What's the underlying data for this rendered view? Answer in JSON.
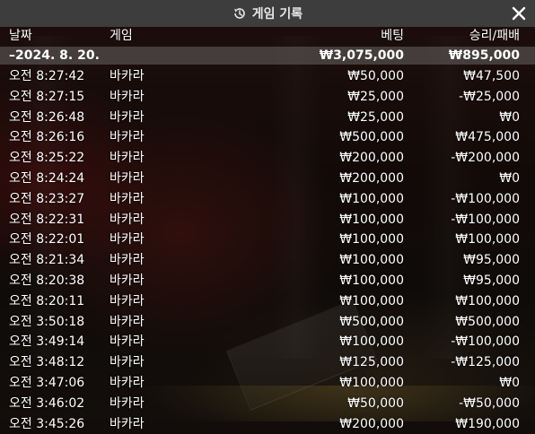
{
  "title": "게임 기록",
  "columns": {
    "date": "날짜",
    "game": "게임",
    "bet": "베팅",
    "winloss": "승리/패배"
  },
  "total": {
    "date": "–2024. 8. 20.",
    "bet": "₩3,075,000",
    "winloss": "₩895,000"
  },
  "rows": [
    {
      "time": "오전 8:27:42",
      "game": "바카라",
      "bet": "₩50,000",
      "winloss": "₩47,500"
    },
    {
      "time": "오전 8:27:15",
      "game": "바카라",
      "bet": "₩25,000",
      "winloss": "-₩25,000"
    },
    {
      "time": "오전 8:26:48",
      "game": "바카라",
      "bet": "₩25,000",
      "winloss": "₩0"
    },
    {
      "time": "오전 8:26:16",
      "game": "바카라",
      "bet": "₩500,000",
      "winloss": "₩475,000"
    },
    {
      "time": "오전 8:25:22",
      "game": "바카라",
      "bet": "₩200,000",
      "winloss": "-₩200,000"
    },
    {
      "time": "오전 8:24:24",
      "game": "바카라",
      "bet": "₩200,000",
      "winloss": "₩0"
    },
    {
      "time": "오전 8:23:27",
      "game": "바카라",
      "bet": "₩100,000",
      "winloss": "-₩100,000"
    },
    {
      "time": "오전 8:22:31",
      "game": "바카라",
      "bet": "₩100,000",
      "winloss": "-₩100,000"
    },
    {
      "time": "오전 8:22:01",
      "game": "바카라",
      "bet": "₩100,000",
      "winloss": "₩100,000"
    },
    {
      "time": "오전 8:21:34",
      "game": "바카라",
      "bet": "₩100,000",
      "winloss": "₩95,000"
    },
    {
      "time": "오전 8:20:38",
      "game": "바카라",
      "bet": "₩100,000",
      "winloss": "₩95,000"
    },
    {
      "time": "오전 8:20:11",
      "game": "바카라",
      "bet": "₩100,000",
      "winloss": "₩100,000"
    },
    {
      "time": "오전 3:50:18",
      "game": "바카라",
      "bet": "₩500,000",
      "winloss": "₩500,000"
    },
    {
      "time": "오전 3:49:14",
      "game": "바카라",
      "bet": "₩100,000",
      "winloss": "-₩100,000"
    },
    {
      "time": "오전 3:48:12",
      "game": "바카라",
      "bet": "₩125,000",
      "winloss": "-₩125,000"
    },
    {
      "time": "오전 3:47:06",
      "game": "바카라",
      "bet": "₩100,000",
      "winloss": "₩0"
    },
    {
      "time": "오전 3:46:02",
      "game": "바카라",
      "bet": "₩50,000",
      "winloss": "-₩50,000"
    },
    {
      "time": "오전 3:45:26",
      "game": "바카라",
      "bet": "₩200,000",
      "winloss": "₩190,000"
    }
  ],
  "icons": {
    "history": "history-icon",
    "close": "close-icon"
  },
  "colors": {
    "titlebar": "#3d3d3d",
    "total_row": "#6b6b6b",
    "text": "#ffffff"
  }
}
